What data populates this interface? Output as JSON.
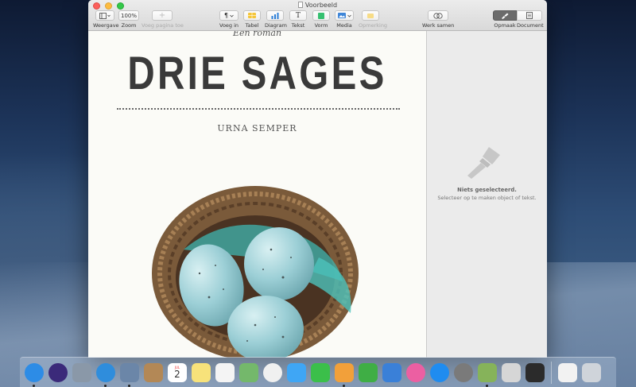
{
  "window": {
    "title": "Voorbeeld"
  },
  "toolbar": {
    "view": {
      "label": "Weergave"
    },
    "zoom": {
      "label": "Zoom",
      "value": "100%"
    },
    "add_page": {
      "label": "Voeg pagina toe"
    },
    "insert": {
      "label": "Voeg in"
    },
    "table": {
      "label": "Tabel"
    },
    "chart": {
      "label": "Diagram"
    },
    "text": {
      "label": "Tekst"
    },
    "shape": {
      "label": "Vorm"
    },
    "media": {
      "label": "Media"
    },
    "comment": {
      "label": "Opmerking"
    },
    "collaborate": {
      "label": "Werk samen"
    },
    "format": {
      "label": "Opmaak"
    },
    "document": {
      "label": "Document"
    }
  },
  "document": {
    "subtitle": "Een roman",
    "title": "DRIE SAGES",
    "author": "URNA SEMPER"
  },
  "inspector": {
    "title": "Niets geselecteerd.",
    "hint": "Selecteer op te maken object of tekst."
  },
  "calendar": {
    "month": "JUL",
    "day": "2"
  },
  "colors": {
    "accent": "#6b6b6b",
    "egg": "#9ccfd6",
    "feather": "#3fb5b0"
  },
  "dock": [
    {
      "name": "finder-icon",
      "color": "#2d8ce6"
    },
    {
      "name": "siri-icon",
      "color": "#3b2a7a"
    },
    {
      "name": "launchpad-icon",
      "color": "#8a98a8"
    },
    {
      "name": "safari-icon",
      "color": "#2f8ddc"
    },
    {
      "name": "preview-photo-icon",
      "color": "#6b86a8"
    },
    {
      "name": "contacts-icon",
      "color": "#b38856"
    },
    {
      "name": "calendar-icon",
      "color": "#ffffff"
    },
    {
      "name": "notes-icon",
      "color": "#f7e27a"
    },
    {
      "name": "reminders-icon",
      "color": "#f4f4f4"
    },
    {
      "name": "maps-icon",
      "color": "#74b86b"
    },
    {
      "name": "photos-icon",
      "color": "#f0f0f0"
    },
    {
      "name": "messages-icon",
      "color": "#3fa6f5"
    },
    {
      "name": "facetime-icon",
      "color": "#3bbf4a"
    },
    {
      "name": "pages-icon",
      "color": "#f2a03a"
    },
    {
      "name": "numbers-icon",
      "color": "#3fae45"
    },
    {
      "name": "keynote-icon",
      "color": "#3a80d8"
    },
    {
      "name": "itunes-icon",
      "color": "#ec5fa2"
    },
    {
      "name": "app-store-icon",
      "color": "#1f8cf0"
    },
    {
      "name": "system-preferences-icon",
      "color": "#7a7a7a"
    },
    {
      "name": "grape-app-icon",
      "color": "#86b35a"
    },
    {
      "name": "slack-icon",
      "color": "#d6d6d6"
    },
    {
      "name": "terminal-icon",
      "color": "#2b2b2b"
    },
    {
      "name": "document-file-icon",
      "color": "#f2f2f2"
    },
    {
      "name": "trash-icon",
      "color": "#cfd4da"
    }
  ]
}
